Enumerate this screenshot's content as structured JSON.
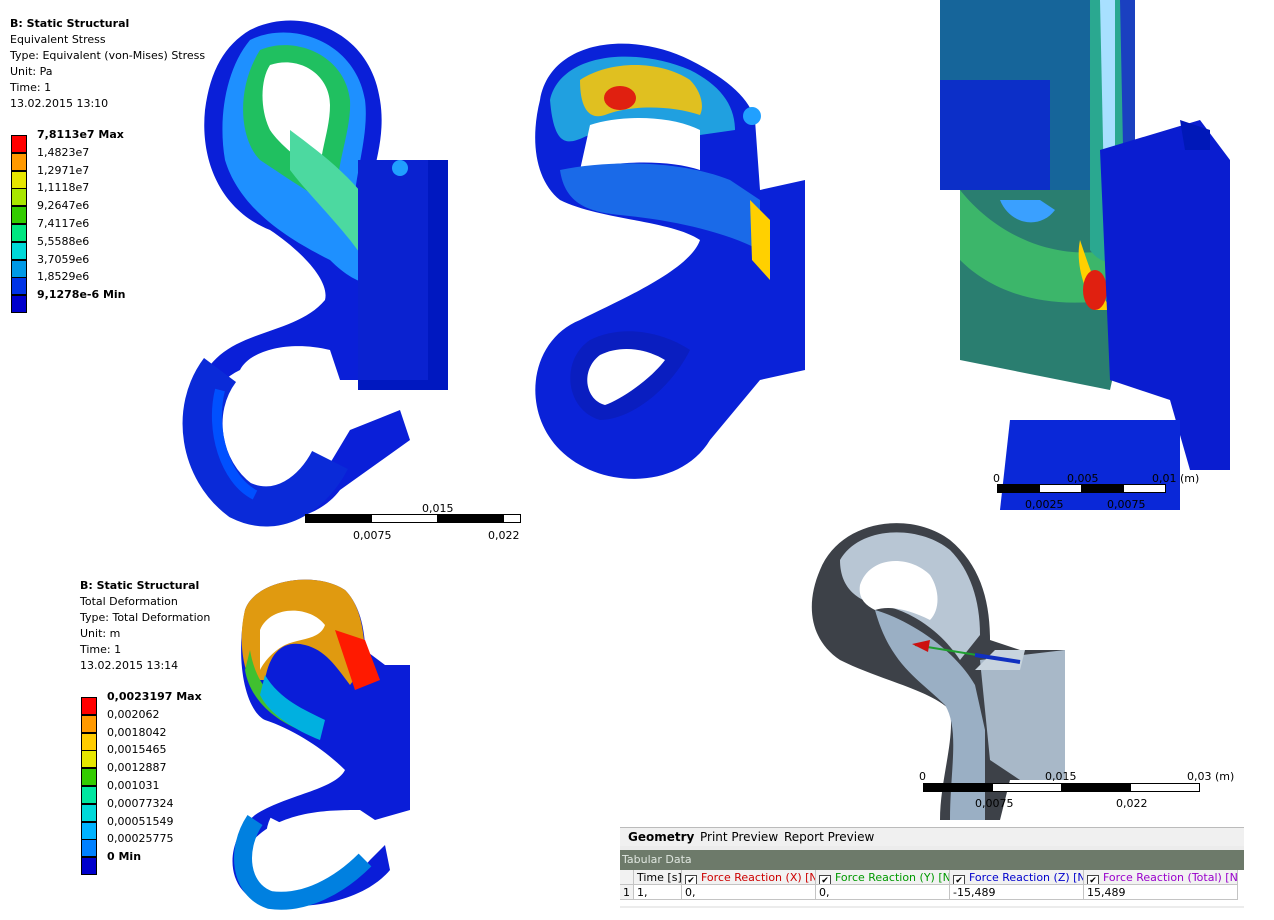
{
  "stress": {
    "title": "B: Static Structural",
    "result": "Equivalent Stress",
    "type": "Type: Equivalent (von-Mises) Stress",
    "unit": "Unit: Pa",
    "time": "Time: 1",
    "date": "13.02.2015 13:10",
    "legend": [
      {
        "label": "7,8113e7 Max",
        "color": "#ff0000",
        "bold": true
      },
      {
        "label": "1,4823e7",
        "color": "#ff9900"
      },
      {
        "label": "1,2971e7",
        "color": "#e6e600"
      },
      {
        "label": "1,1118e7",
        "color": "#a8e600"
      },
      {
        "label": "9,2647e6",
        "color": "#33cc00"
      },
      {
        "label": "7,4117e6",
        "color": "#00e680"
      },
      {
        "label": "5,5588e6",
        "color": "#00d9d9"
      },
      {
        "label": "3,7059e6",
        "color": "#0099e6"
      },
      {
        "label": "1,8529e6",
        "color": "#0033e6"
      },
      {
        "label": "9,1278e-6 Min",
        "color": "#0000cc",
        "bold": true
      }
    ],
    "scale": {
      "t0": "0,015",
      "t1": "0,0075",
      "t2": "0,022"
    }
  },
  "zoom_scale": {
    "t0": "0",
    "t1": "0,005",
    "t2": "0,01 (m)",
    "t3": "0,0025",
    "t4": "0,0075"
  },
  "deform": {
    "title": "B: Static Structural",
    "result": "Total Deformation",
    "type": "Type: Total Deformation",
    "unit": "Unit: m",
    "time": "Time: 1",
    "date": "13.02.2015 13:14",
    "legend": [
      {
        "label": "0,0023197 Max",
        "color": "#ff0000",
        "bold": true
      },
      {
        "label": "0,002062",
        "color": "#ff9900"
      },
      {
        "label": "0,0018042",
        "color": "#ffcc00"
      },
      {
        "label": "0,0015465",
        "color": "#e6e600"
      },
      {
        "label": "0,0012887",
        "color": "#33cc00"
      },
      {
        "label": "0,001031",
        "color": "#00e6a0"
      },
      {
        "label": "0,00077324",
        "color": "#00d9d9"
      },
      {
        "label": "0,00051549",
        "color": "#00b3ff"
      },
      {
        "label": "0,00025775",
        "color": "#0080ff"
      },
      {
        "label": "0 Min",
        "color": "#0000cc",
        "bold": true
      }
    ]
  },
  "geom_scale": {
    "t0": "0",
    "t1": "0,015",
    "t2": "0,03 (m)",
    "t3": "0,0075",
    "t4": "0,022"
  },
  "panel": {
    "tabs": [
      "Geometry",
      "Print Preview",
      "Report Preview"
    ],
    "tabular_label": "Tabular Data",
    "headers": {
      "time": "Time [s]",
      "fx": "Force Reaction (X) [N]",
      "fy": "Force Reaction (Y) [N]",
      "fz": "Force Reaction (Z) [N]",
      "ft": "Force Reaction (Total) [N]"
    },
    "row": {
      "idx": "1",
      "time": "1,",
      "fx": "0,",
      "fy": "0,",
      "fz": "-15,489",
      "ft": "15,489"
    },
    "colors": {
      "fx": "#cc0000",
      "fy": "#009900",
      "fz": "#0000cc",
      "ft": "#9900cc"
    }
  }
}
